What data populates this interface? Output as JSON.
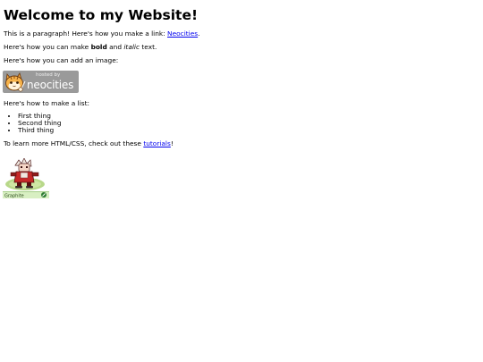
{
  "page": {
    "title": "Welcome to my Website!",
    "intro_text": "This is a paragraph! Here's how you make a link: ",
    "intro_link": "Neocities",
    "intro_end": ".",
    "format_prefix": "Here's how you can make ",
    "bold_word": "bold",
    "format_and": " and ",
    "italic_word": "italic",
    "format_suffix": " text.",
    "image_text": "Here's how you can add an image:",
    "badge": {
      "small_text": "hosted by",
      "big_text": "neocities",
      "icon": "cat-icon"
    },
    "list_text": "Here's how to make a list:",
    "list_items": [
      "First thing",
      "Second thing",
      "Third thing"
    ],
    "learn_prefix": "To learn more HTML/CSS, check out these ",
    "learn_link": "tutorials",
    "learn_suffix": "!",
    "graphic": {
      "label": "Graphite",
      "icon": "pixel-character-icon"
    }
  },
  "colors": {
    "link": "#0000ee",
    "badge_background": "#9a9a9a"
  }
}
